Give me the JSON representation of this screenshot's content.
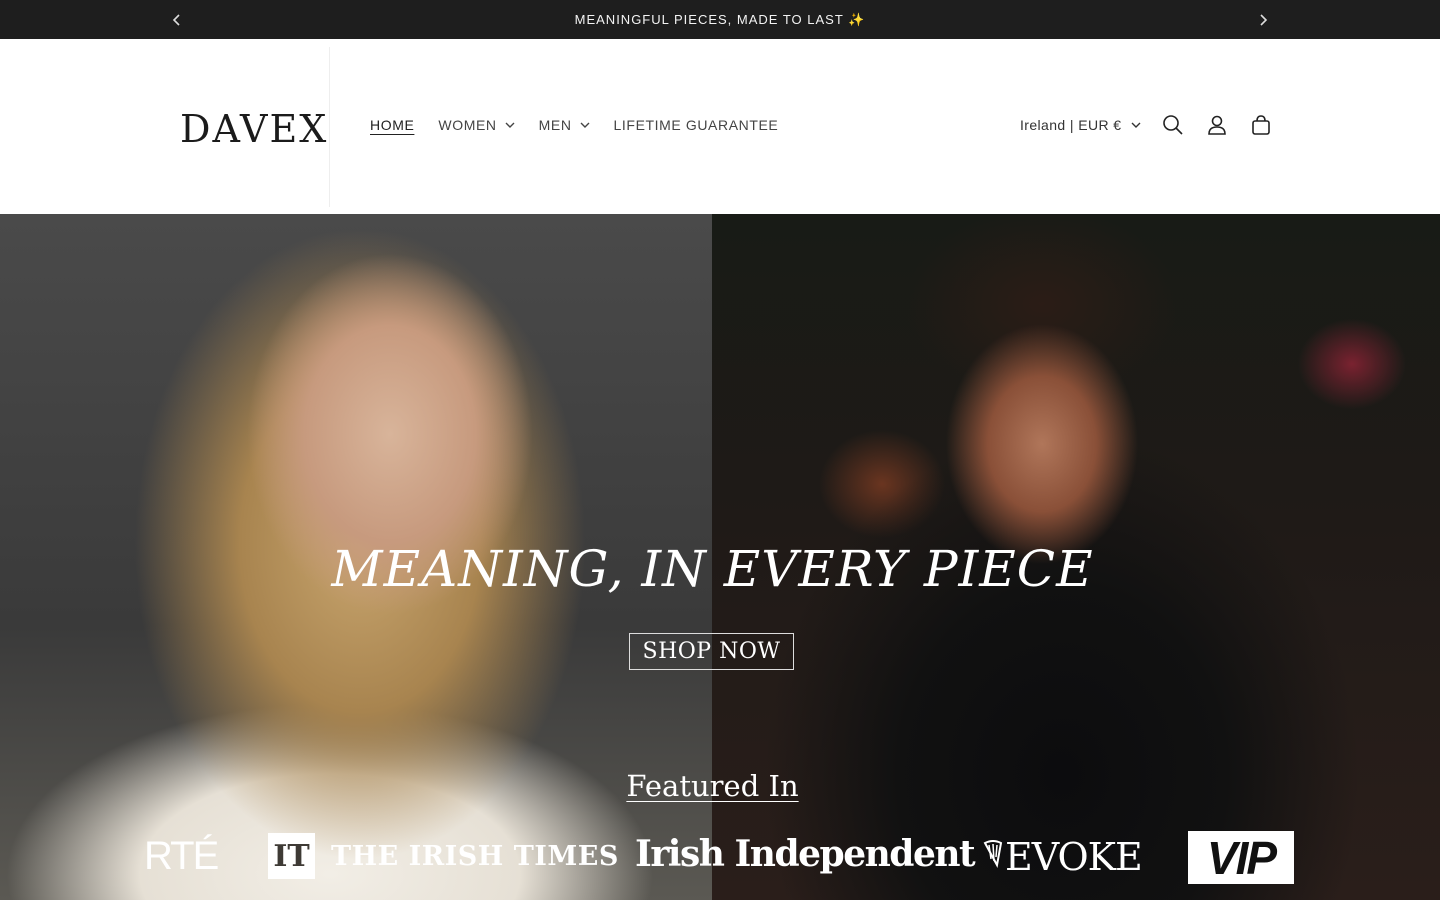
{
  "announcement": {
    "message": "MEANINGFUL PIECES, MADE TO LAST ✨",
    "prev_icon": "chevron-left-icon",
    "next_icon": "chevron-right-icon"
  },
  "header": {
    "logo": "DAVEX",
    "nav": [
      {
        "label": "HOME",
        "active": true
      },
      {
        "label": "WOMEN",
        "has_dropdown": true
      },
      {
        "label": "MEN",
        "has_dropdown": true
      },
      {
        "label": "LIFETIME GUARANTEE"
      }
    ],
    "locale": "Ireland | EUR €",
    "icons": [
      "search-icon",
      "account-icon",
      "cart-icon"
    ]
  },
  "hero": {
    "title": "MEANING, IN EVERY PIECE",
    "cta_label": "SHOP NOW",
    "featured_heading": "Featured In",
    "press": {
      "rte": "RTÉ",
      "irish_times_badge": "IT",
      "irish_times": "THE IRISH TIMES",
      "independent": "Irish Independent",
      "evoke": "EVOKE",
      "vip": "VIP"
    }
  }
}
